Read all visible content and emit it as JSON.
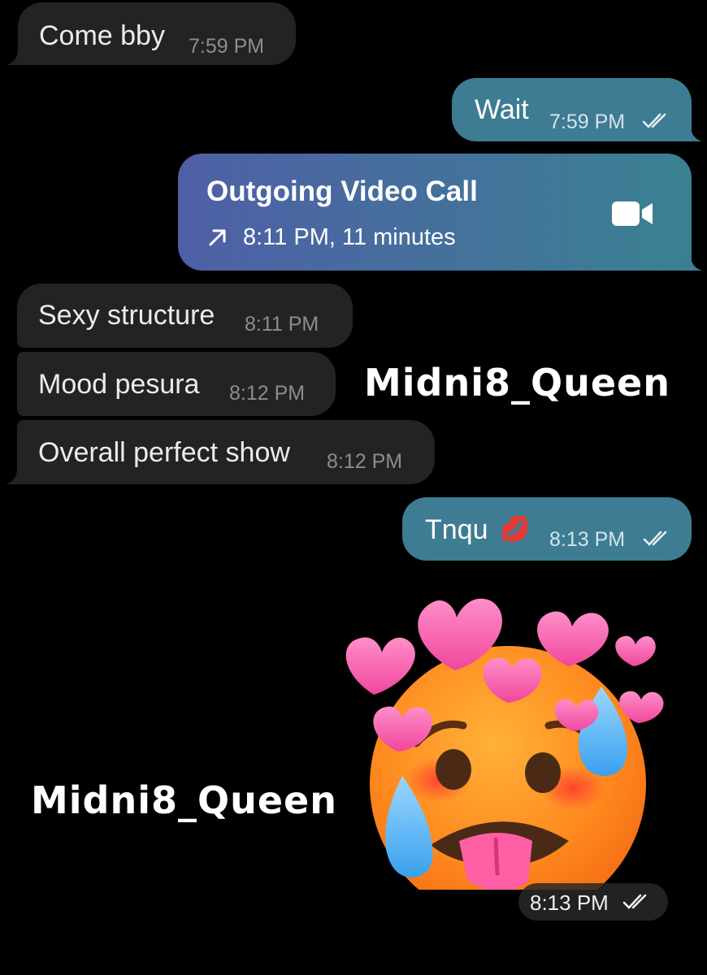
{
  "messages": {
    "m1": {
      "text": "Come bby",
      "time": "7:59 PM"
    },
    "m2": {
      "text": "Wait",
      "time": "7:59 PM"
    },
    "call": {
      "title": "Outgoing Video Call",
      "detail": "8:11 PM, 11 minutes",
      "icon": "video-camera-icon",
      "arrow_icon": "arrow-up-right-icon"
    },
    "m3": {
      "text": "Sexy structure",
      "time": "8:11 PM"
    },
    "m4": {
      "text": "Mood pesura",
      "time": "8:12 PM"
    },
    "m5": {
      "text": "Overall perfect show",
      "time": "8:12 PM"
    },
    "m6": {
      "text": "Tnqu",
      "emoji": "💋",
      "time": "8:13 PM"
    },
    "sticker": {
      "time": "8:13 PM",
      "description_icon": "hot-face-hearts-sticker"
    }
  },
  "watermarks": {
    "top": "Midni8_Queen",
    "bottom": "Midni8_Queen"
  },
  "colors": {
    "background": "#000000",
    "incoming_bubble": "#232323",
    "outgoing_bubble": "#3d7c93",
    "call_gradient_start": "#4f5fa6",
    "call_gradient_end": "#3a8192"
  }
}
